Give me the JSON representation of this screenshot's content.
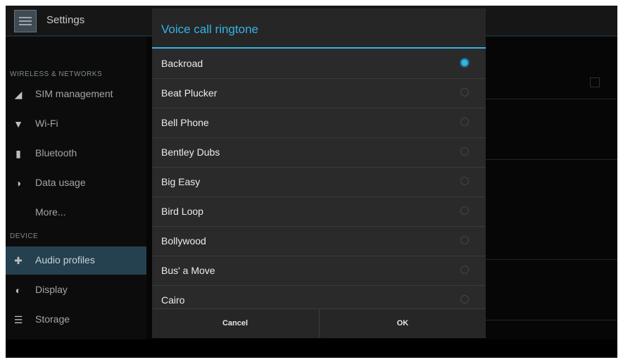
{
  "app": {
    "title": "Settings",
    "icon": "settings-icon"
  },
  "sidebar": {
    "sections": [
      {
        "label": "WIRELESS & NETWORKS"
      },
      {
        "label": "DEVICE"
      }
    ],
    "items": [
      {
        "label": "SIM management",
        "icon": "sim-icon"
      },
      {
        "label": "Wi-Fi",
        "icon": "wifi-icon"
      },
      {
        "label": "Bluetooth",
        "icon": "bluetooth-icon"
      },
      {
        "label": "Data usage",
        "icon": "data-usage-icon"
      },
      {
        "label": "More...",
        "icon": ""
      },
      {
        "label": "Audio profiles",
        "icon": "audio-profiles-icon",
        "selected": true
      },
      {
        "label": "Display",
        "icon": "display-icon"
      },
      {
        "label": "Storage",
        "icon": "storage-icon"
      }
    ]
  },
  "dialog": {
    "title": "Voice call ringtone",
    "selected_index": 0,
    "options": [
      "Backroad",
      "Beat Plucker",
      "Bell Phone",
      "Bentley Dubs",
      "Big Easy",
      "Bird Loop",
      "Bollywood",
      "Bus' a Move",
      "Cairo"
    ],
    "cancel_label": "Cancel",
    "ok_label": "OK"
  },
  "colors": {
    "accent": "#33b5e5",
    "selected_bg": "#25414f"
  }
}
